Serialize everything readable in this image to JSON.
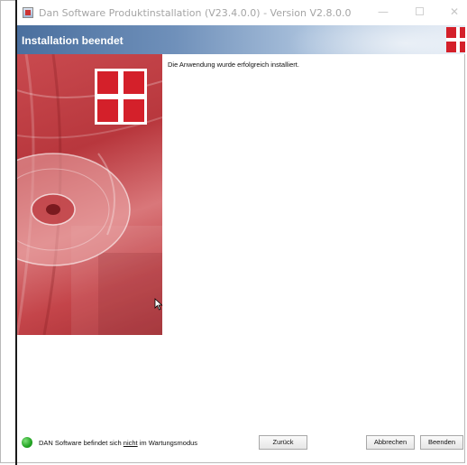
{
  "window": {
    "title": "Dan Software Produktinstallation (V23.4.0.0) - Version V2.8.0.0",
    "minimize_glyph": "—",
    "close_glyph": "✕"
  },
  "header": {
    "heading": "Installation beendet"
  },
  "content": {
    "message": "Die Anwendung wurde erfolgreich installiert."
  },
  "status": {
    "text_before": "DAN Software befindet sich ",
    "text_emphasis": "nicht",
    "text_after": " im Wartungsmodus",
    "indicator_color": "#22a323"
  },
  "buttons": {
    "back": "Zurück",
    "cancel": "Abbrechen",
    "finish": "Beenden"
  },
  "colors": {
    "brand_red": "#d4202a",
    "header_blue": "#4a6f9e"
  }
}
